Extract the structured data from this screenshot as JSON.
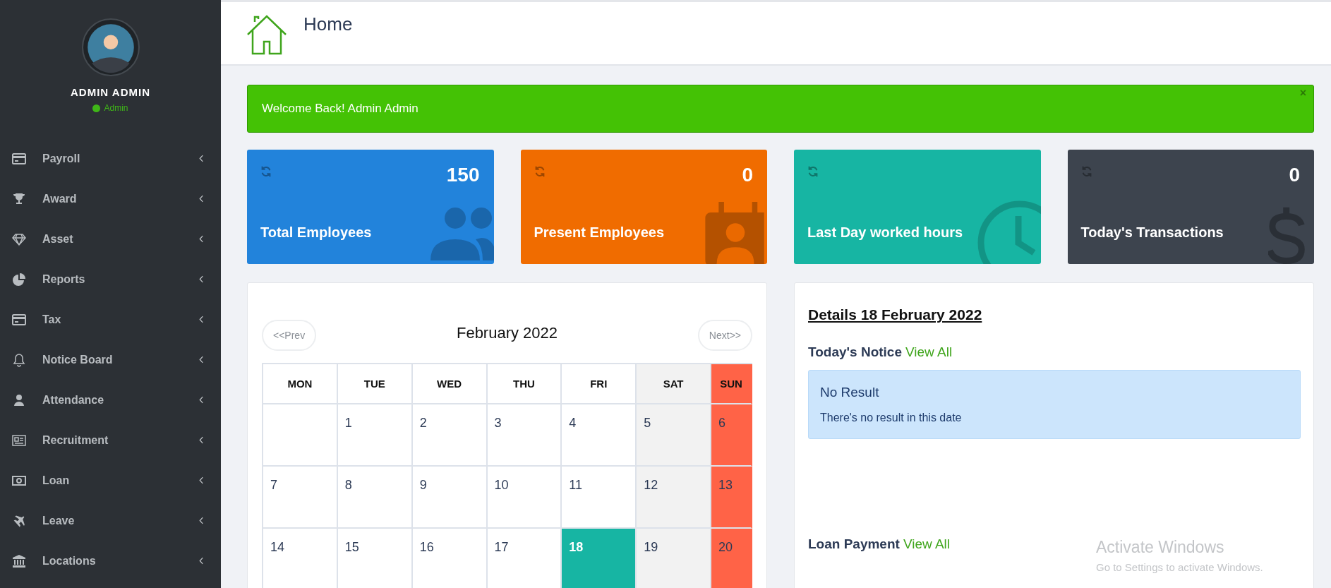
{
  "sidebar": {
    "user": {
      "name": "ADMIN ADMIN",
      "role": "Admin",
      "online": true
    },
    "items": [
      {
        "label": "Payroll",
        "kind": "card"
      },
      {
        "label": "Award",
        "kind": "trophy"
      },
      {
        "label": "Asset",
        "kind": "diamond"
      },
      {
        "label": "Reports",
        "kind": "pie"
      },
      {
        "label": "Tax",
        "kind": "card"
      },
      {
        "label": "Notice Board",
        "kind": "bell"
      },
      {
        "label": "Attendance",
        "kind": "user"
      },
      {
        "label": "Recruitment",
        "kind": "newspaper"
      },
      {
        "label": "Loan",
        "kind": "money"
      },
      {
        "label": "Leave",
        "kind": "plane"
      },
      {
        "label": "Locations",
        "kind": "bank"
      }
    ]
  },
  "header": {
    "title": "Home"
  },
  "alert": {
    "text": "Welcome Back! Admin Admin",
    "close": "×"
  },
  "stats": [
    {
      "value": "150",
      "label": "Total Employees",
      "color": "#2283db",
      "kind": "people"
    },
    {
      "value": "0",
      "label": "Present Employees",
      "color": "#f06c00",
      "kind": "badge"
    },
    {
      "label": "Last Day worked hours",
      "color": "#17b5a3",
      "kind": "clock"
    },
    {
      "value": "0",
      "label": "Today's Transactions",
      "color": "#3d444e",
      "kind": "dollar"
    }
  ],
  "calendar": {
    "prev": "<<Prev",
    "title": "February 2022",
    "next": "Next>>",
    "weekdays": [
      {
        "label": "MON",
        "kind": "weekday"
      },
      {
        "label": "TUE",
        "kind": "weekday"
      },
      {
        "label": "WED",
        "kind": "weekday"
      },
      {
        "label": "THU",
        "kind": "weekday"
      },
      {
        "label": "FRI",
        "kind": "weekday"
      },
      {
        "label": "SAT",
        "kind": "saturday"
      },
      {
        "label": "SUN",
        "kind": "sunday"
      }
    ],
    "weeks": [
      [
        {
          "kind": "weekday",
          "selected": false
        },
        {
          "day": "1",
          "kind": "weekday",
          "selected": false
        },
        {
          "day": "2",
          "kind": "weekday",
          "selected": false
        },
        {
          "day": "3",
          "kind": "weekday",
          "selected": false
        },
        {
          "day": "4",
          "kind": "weekday",
          "selected": false
        },
        {
          "day": "5",
          "kind": "saturday",
          "selected": false
        },
        {
          "day": "6",
          "kind": "sunday",
          "selected": false
        }
      ],
      [
        {
          "day": "7",
          "kind": "weekday",
          "selected": false
        },
        {
          "day": "8",
          "kind": "weekday",
          "selected": false
        },
        {
          "day": "9",
          "kind": "weekday",
          "selected": false
        },
        {
          "day": "10",
          "kind": "weekday",
          "selected": false
        },
        {
          "day": "11",
          "kind": "weekday",
          "selected": false
        },
        {
          "day": "12",
          "kind": "saturday",
          "selected": false
        },
        {
          "day": "13",
          "kind": "sunday",
          "selected": false
        }
      ],
      [
        {
          "day": "14",
          "kind": "weekday",
          "selected": false
        },
        {
          "day": "15",
          "kind": "weekday",
          "selected": false
        },
        {
          "day": "16",
          "kind": "weekday",
          "selected": false
        },
        {
          "day": "17",
          "kind": "weekday",
          "selected": false
        },
        {
          "day": "18",
          "kind": "weekday",
          "selected": true
        },
        {
          "day": "19",
          "kind": "saturday",
          "selected": false
        },
        {
          "day": "20",
          "kind": "sunday",
          "selected": false
        }
      ]
    ]
  },
  "details": {
    "title": "Details 18 February 2022",
    "sections": [
      {
        "heading": "Today's Notice",
        "link": "View All",
        "empty": {
          "title": "No Result",
          "text": "There's no result in this date"
        }
      },
      {
        "heading": "Loan Payment",
        "link": "View All"
      }
    ]
  },
  "os_overlay": {
    "title": "Activate Windows",
    "text": "Go to Settings to activate Windows."
  }
}
